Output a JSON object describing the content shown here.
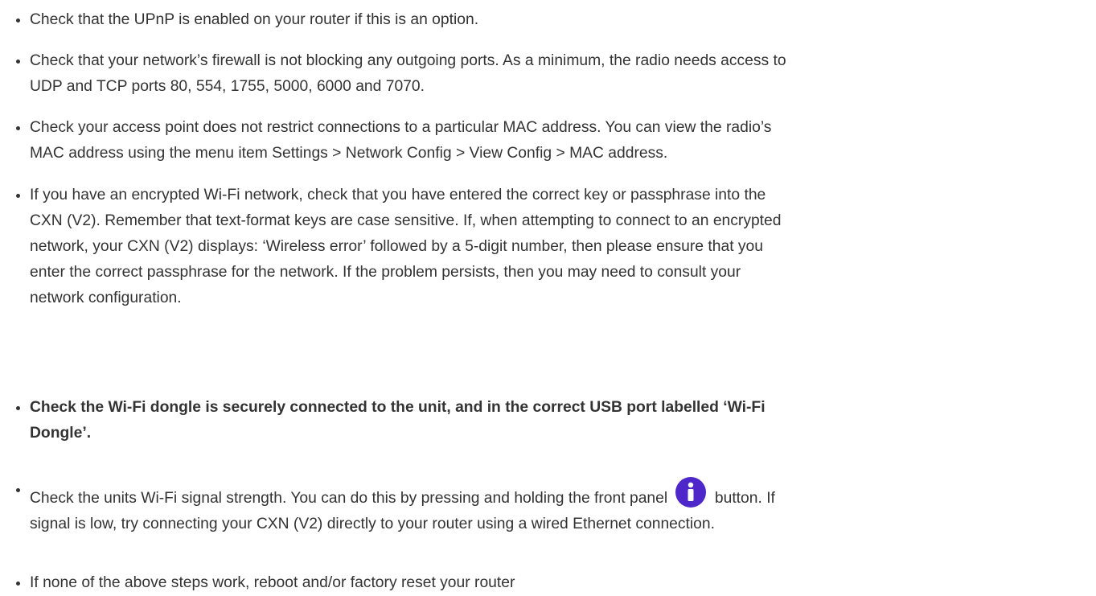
{
  "items": [
    {
      "lines": [
        "Check that the UPnP is enabled on your router if this is an option."
      ]
    },
    {
      "lines": [
        "Check that your network’s firewall is not blocking any outgoing ports. As a minimum, the radio needs access to",
        "UDP and TCP ports 80, 554, 1755, 5000, 6000 and 7070."
      ]
    },
    {
      "lines": [
        "Check your access point does not restrict connections to a particular MAC address. You can view the radio’s",
        "MAC address using the menu item Settings > Network Config > View Config > MAC address."
      ]
    },
    {
      "lines": [
        "If you have an encrypted Wi-Fi network, check that you have entered the correct key or passphrase into the",
        "CXN (V2). Remember that text-format keys are case sensitive. If, when attempting to connect to an encrypted",
        "network, your CXN (V2) displays: ‘Wireless error’ followed by a 5-digit number, then please ensure that you",
        "enter the correct passphrase for the network. If the problem persists, then you may need to consult your",
        "network configuration."
      ]
    },
    {
      "lines": [
        "Check the Wi-Fi dongle is securely connected to the unit, and in the correct USB port labelled ‘Wi-Fi",
        "Dongle’."
      ]
    },
    {
      "line1_before": "Check the units Wi-Fi signal strength. You can do this by pressing and holding the front panel",
      "line1_after": "button. If",
      "line2": "signal is low, try connecting your CXN (V2) directly to your router using a wired Ethernet connection.",
      "icon": "info-icon",
      "icon_color": "#4d27c9"
    },
    {
      "lines": [
        "If none of the above steps work, reboot and/or factory reset your router"
      ]
    }
  ],
  "colors": {
    "text": "#333333",
    "accent": "#4d27c9"
  }
}
